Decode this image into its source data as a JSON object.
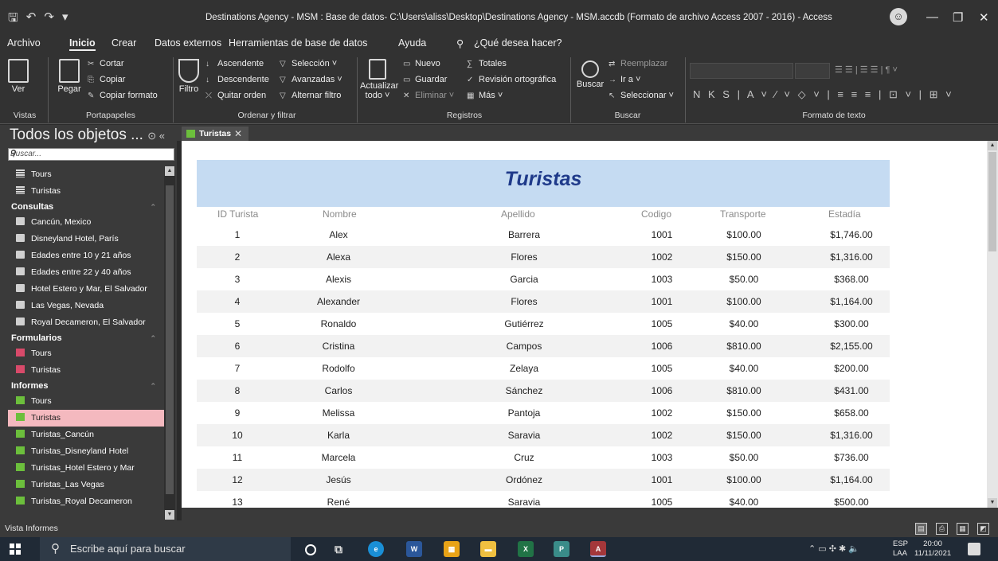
{
  "titlebar": {
    "title": "Destinations Agency - MSM : Base de datos- C:\\Users\\aliss\\Desktop\\Destinations Agency - MSM.accdb (Formato de archivo Access 2007 - 2016)  -  Access",
    "minimize": "—",
    "restore": "❐",
    "close": "✕"
  },
  "menu": {
    "items": [
      "Archivo",
      "Inicio",
      "Crear",
      "Datos externos",
      "Herramientas de base de datos",
      "Ayuda"
    ],
    "tell_me": "¿Qué desea hacer?",
    "active_index": 1
  },
  "ribbon": {
    "vistas": {
      "ver": "Ver",
      "label": "Vistas"
    },
    "portapapeles": {
      "pegar": "Pegar",
      "cortar": "Cortar",
      "copiar": "Copiar",
      "copiar_formato": "Copiar formato",
      "label": "Portapapeles"
    },
    "ordenar": {
      "filtro": "Filtro",
      "ascendente": "Ascendente",
      "descendente": "Descendente",
      "quitar_orden": "Quitar orden",
      "seleccion": "Selección ˅",
      "avanzadas": "Avanzadas ˅",
      "alternar_filtro": "Alternar filtro",
      "label": "Ordenar y filtrar"
    },
    "registros": {
      "actualizar": "Actualizar",
      "todo": "todo ˅",
      "nuevo": "Nuevo",
      "guardar": "Guardar",
      "eliminar": "Eliminar ˅",
      "totales": "Totales",
      "revision": "Revisión ortográfica",
      "mas": "Más ˅",
      "label": "Registros"
    },
    "buscar": {
      "buscar": "Buscar",
      "reemplazar": "Reemplazar",
      "ir_a": "Ir a ˅",
      "seleccionar": "Seleccionar ˅",
      "label": "Buscar"
    },
    "formato": {
      "row": "N  K  S  |  A ˅  ⁄ ˅  ◇ ˅  |  ≡  ≡  ≡  |  ⊡ ˅  |  ⊞ ˅",
      "label": "Formato de texto"
    }
  },
  "nav": {
    "title": "Todos los objetos ...",
    "search_placeholder": "Buscar...",
    "tables": [
      {
        "label": "Tours"
      },
      {
        "label": "Turistas"
      }
    ],
    "queries_header": "Consultas",
    "queries": [
      {
        "label": "Cancún, Mexico"
      },
      {
        "label": "Disneyland Hotel, París"
      },
      {
        "label": "Edades entre 10 y 21 años"
      },
      {
        "label": "Edades entre 22 y 40 años"
      },
      {
        "label": "Hotel Estero y Mar, El Salvador"
      },
      {
        "label": "Las Vegas, Nevada"
      },
      {
        "label": "Royal Decameron, El Salvador"
      }
    ],
    "forms_header": "Formularios",
    "forms": [
      {
        "label": "Tours"
      },
      {
        "label": "Turistas"
      }
    ],
    "reports_header": "Informes",
    "reports": [
      {
        "label": "Tours"
      },
      {
        "label": "Turistas"
      },
      {
        "label": "Turistas_Cancún"
      },
      {
        "label": "Turistas_Disneyland Hotel"
      },
      {
        "label": "Turistas_Hotel Estero y Mar"
      },
      {
        "label": "Turistas_Las Vegas"
      },
      {
        "label": "Turistas_Royal Decameron"
      }
    ],
    "selected_report_index": 1
  },
  "tab": {
    "label": "Turistas",
    "close": "✕"
  },
  "report": {
    "title": "Turistas",
    "columns": [
      "ID Turista",
      "Nombre",
      "Apellido",
      "Codigo",
      "Transporte",
      "Estadía"
    ],
    "rows": [
      [
        "1",
        "Alex",
        "Barrera",
        "1001",
        "$100.00",
        "$1,746.00"
      ],
      [
        "2",
        "Alexa",
        "Flores",
        "1002",
        "$150.00",
        "$1,316.00"
      ],
      [
        "3",
        "Alexis",
        "Garcia",
        "1003",
        "$50.00",
        "$368.00"
      ],
      [
        "4",
        "Alexander",
        "Flores",
        "1001",
        "$100.00",
        "$1,164.00"
      ],
      [
        "5",
        "Ronaldo",
        "Gutiérrez",
        "1005",
        "$40.00",
        "$300.00"
      ],
      [
        "6",
        "Cristina",
        "Campos",
        "1006",
        "$810.00",
        "$2,155.00"
      ],
      [
        "7",
        "Rodolfo",
        "Zelaya",
        "1005",
        "$40.00",
        "$200.00"
      ],
      [
        "8",
        "Carlos",
        "Sánchez",
        "1006",
        "$810.00",
        "$431.00"
      ],
      [
        "9",
        "Melissa",
        "Pantoja",
        "1002",
        "$150.00",
        "$658.00"
      ],
      [
        "10",
        "Karla",
        "Saravia",
        "1002",
        "$150.00",
        "$1,316.00"
      ],
      [
        "11",
        "Marcela",
        "Cruz",
        "1003",
        "$50.00",
        "$736.00"
      ],
      [
        "12",
        "Jesús",
        "Ordónez",
        "1001",
        "$100.00",
        "$1,164.00"
      ],
      [
        "13",
        "René",
        "Saravia",
        "1005",
        "$40.00",
        "$500.00"
      ]
    ]
  },
  "status": {
    "text": "Vista Informes"
  },
  "taskbar": {
    "search_placeholder": "Escribe aquí para buscar",
    "lang1": "ESP",
    "lang2": "LAA",
    "time": "20:00",
    "date": "11/11/2021"
  },
  "colors": {
    "header_band": "#c5dbf2",
    "title_text": "#1f3a8a",
    "selected_nav": "#f4b9bf",
    "report_icon": "#6cbf3c"
  }
}
